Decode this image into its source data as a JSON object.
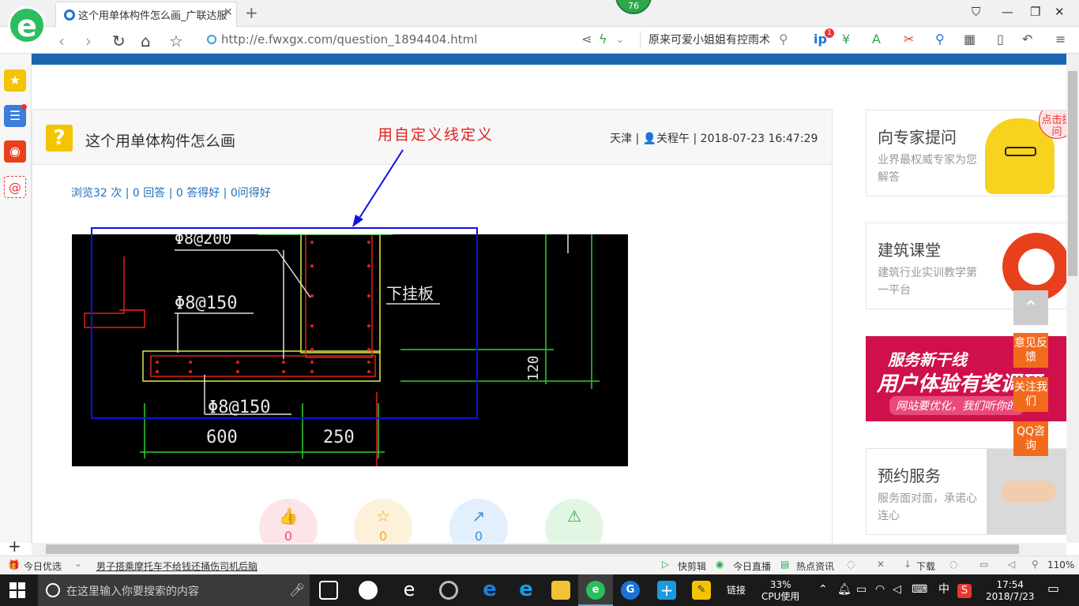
{
  "browser": {
    "tab_title": "这个用单体构件怎么画_广联达服",
    "url": "http://e.fwxgx.com/question_1894404.html",
    "search_text": "原来可爱小姐姐有控雨术",
    "badge": "76",
    "notif_count": "1"
  },
  "question": {
    "title": "这个用单体构件怎么画",
    "meta": "天津 | 👤关程午 | 2018-07-23 16:47:29",
    "stats": "浏览32 次 | 0 回答 | 0 答得好 | 0问得好",
    "annotation": "用自定义线定义"
  },
  "cad": {
    "labels": [
      "Φ8@200",
      "Φ8@150",
      "下挂板",
      "Φ8@150",
      "600",
      "250",
      "120"
    ]
  },
  "actions": [
    {
      "icon": "thumbs-up-icon",
      "count": "0",
      "color": "#fde4e6",
      "fg": "#e0506a"
    },
    {
      "icon": "star-icon",
      "count": "0",
      "color": "#fdf1da",
      "fg": "#f0a830"
    },
    {
      "icon": "share-icon",
      "count": "0",
      "color": "#e1f0fc",
      "fg": "#3b8fd8"
    },
    {
      "icon": "warning-icon",
      "count": "",
      "color": "#e2f6e4",
      "fg": "#39a84a"
    }
  ],
  "right": {
    "expert_title": "向专家提问",
    "expert_sub": "业界最权威专家为您解答",
    "bubble": "点击提问",
    "class_title": "建筑课堂",
    "class_sub": "建筑行业实训教学第一平台",
    "banner_line1": "服务新干线",
    "banner_line2": "用户体验有奖调研",
    "banner_line3": "网站要优化，我们听你的",
    "booking_title": "预约服务",
    "booking_sub": "服务面对面，承诺心连心"
  },
  "float": {
    "feedback": "意见反馈",
    "follow": "关注我们",
    "qq": "QQ咨询"
  },
  "statusbar": {
    "today": "今日优选",
    "news": "男子搭乘摩托车不给钱还捅伤司机后脑",
    "quick_cut": "快剪辑",
    "live": "今日直播",
    "hot": "热点资讯",
    "download": "下载",
    "zoom": "110%"
  },
  "taskbar": {
    "search_placeholder": "在这里输入你要搜索的内容",
    "link_label": "链接",
    "cpu": "33%",
    "cpu_label": "CPU使用",
    "ime": "中",
    "time": "17:54",
    "date": "2018/7/23"
  }
}
